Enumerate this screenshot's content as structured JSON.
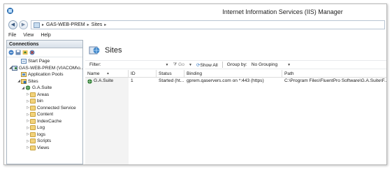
{
  "window": {
    "title": "Internet Information Services (IIS) Manager"
  },
  "address": {
    "crumbs": [
      "GAS-WEB-PREM",
      "Sites"
    ],
    "separator": "▸"
  },
  "menu": [
    "File",
    "View",
    "Help"
  ],
  "connections": {
    "header": "Connections",
    "tree": [
      {
        "label": "Start Page",
        "icon": "start-page-icon",
        "expander": "",
        "level": 1
      },
      {
        "label": "GAS-WEB-PREM (VIACOM\\o...",
        "icon": "server-icon",
        "expander": "◢",
        "level": 0
      },
      {
        "label": "Application Pools",
        "icon": "app-pools-icon",
        "expander": "",
        "level": 1
      },
      {
        "label": "Sites",
        "icon": "sites-icon",
        "expander": "◢",
        "level": 1
      },
      {
        "label": "G.A.Suite",
        "icon": "globe-icon",
        "expander": "◢",
        "level": 2
      },
      {
        "label": "Areas",
        "icon": "folder-icon",
        "expander": "▷",
        "level": 3
      },
      {
        "label": "bin",
        "icon": "folder-icon",
        "expander": "▷",
        "level": 3
      },
      {
        "label": "Connected Service",
        "icon": "folder-icon",
        "expander": "▷",
        "level": 3
      },
      {
        "label": "Content",
        "icon": "folder-icon",
        "expander": "▷",
        "level": 3
      },
      {
        "label": "IndexCache",
        "icon": "folder-icon",
        "expander": "▷",
        "level": 3
      },
      {
        "label": "Log",
        "icon": "folder-icon",
        "expander": "▷",
        "level": 3
      },
      {
        "label": "logs",
        "icon": "folder-icon",
        "expander": "▷",
        "level": 3
      },
      {
        "label": "Scripts",
        "icon": "folder-icon",
        "expander": "▷",
        "level": 3
      },
      {
        "label": "Views",
        "icon": "folder-icon",
        "expander": "▷",
        "level": 3
      }
    ]
  },
  "main": {
    "title": "Sites",
    "filter": {
      "label": "Filter:",
      "go": "Go",
      "show_all": "Show All",
      "group_by_label": "Group by:",
      "group_by_value": "No Grouping"
    },
    "columns": [
      "Name",
      "ID",
      "Status",
      "Binding",
      "Path"
    ],
    "rows": [
      {
        "name": "G.A.Suite",
        "id": "1",
        "status": "Started (ht...",
        "binding": "gprem.qaservers.com on *:443 (https)",
        "path": "C:\\Program Files\\FluentPro Software\\G.A.Suite\\F..."
      }
    ]
  }
}
